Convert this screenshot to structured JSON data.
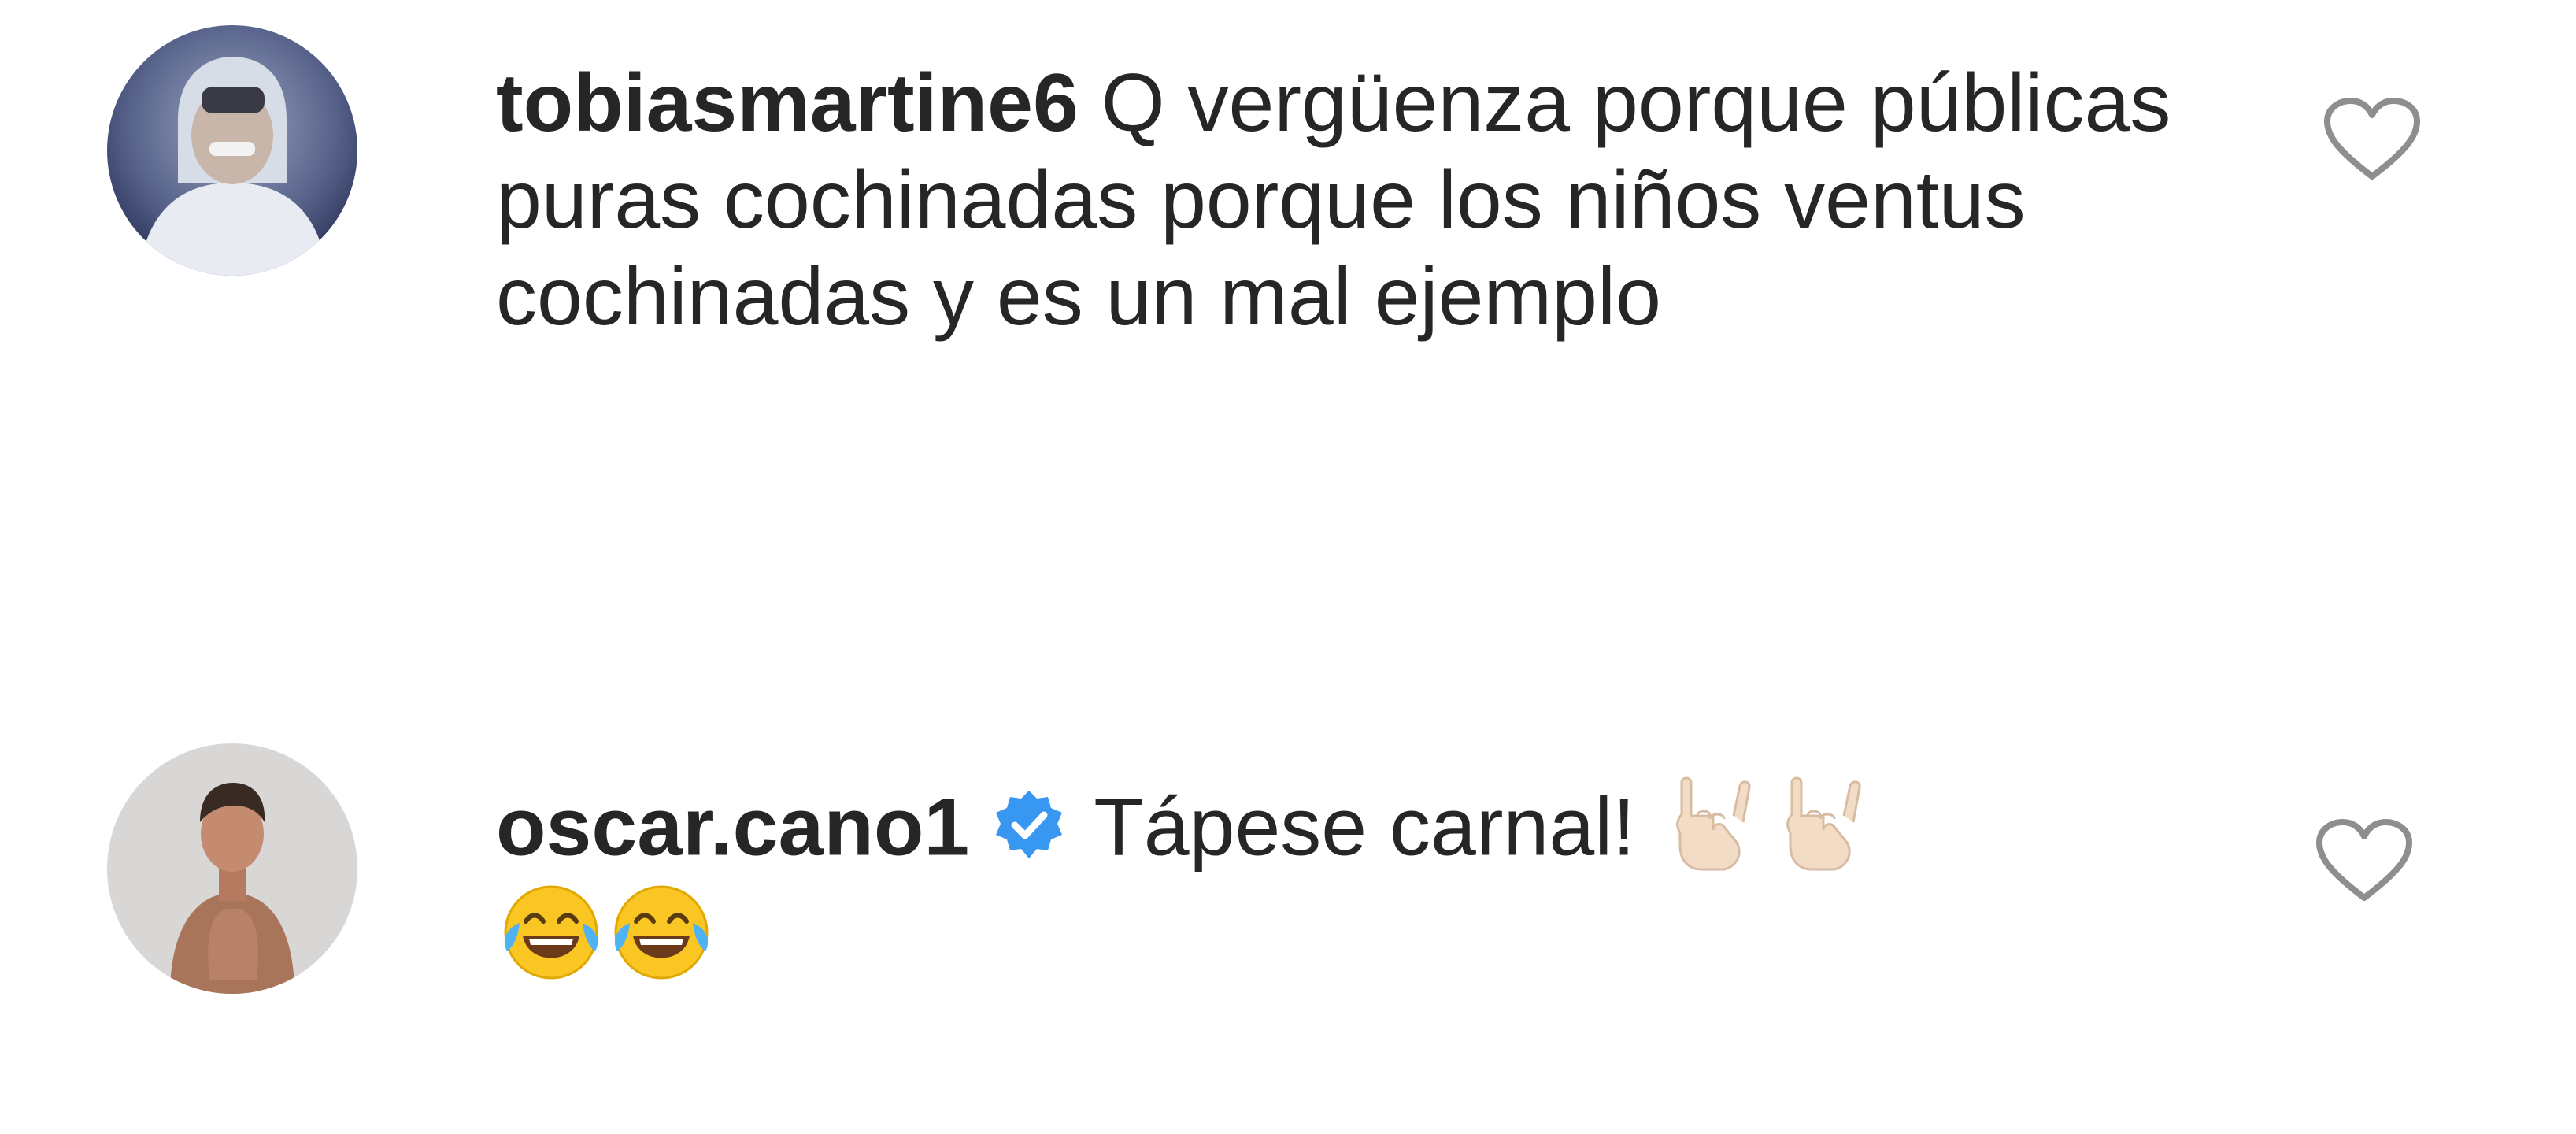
{
  "comments": [
    {
      "username": "tobiasmartine6",
      "verified": false,
      "text": "Q vergüenza porque públicas puras cochinadas porque los niños ventus cochinadas y es un mal ejemplo",
      "avatar_icon": "profile-avatar",
      "like_icon": "heart-outline-icon"
    },
    {
      "username": "oscar.cano1",
      "verified": true,
      "verified_icon": "verified-badge-icon",
      "text": "Tápese carnal!",
      "emojis_inline": [
        "sign-of-the-horns-emoji",
        "sign-of-the-horns-emoji"
      ],
      "emojis_next_line": [
        "face-with-tears-of-joy-emoji",
        "face-with-tears-of-joy-emoji"
      ],
      "avatar_icon": "profile-avatar",
      "like_icon": "heart-outline-icon"
    }
  ],
  "colors": {
    "text": "#262626",
    "verified_blue": "#3897f0",
    "icon_gray": "#8e8e8e",
    "background": "#ffffff"
  }
}
